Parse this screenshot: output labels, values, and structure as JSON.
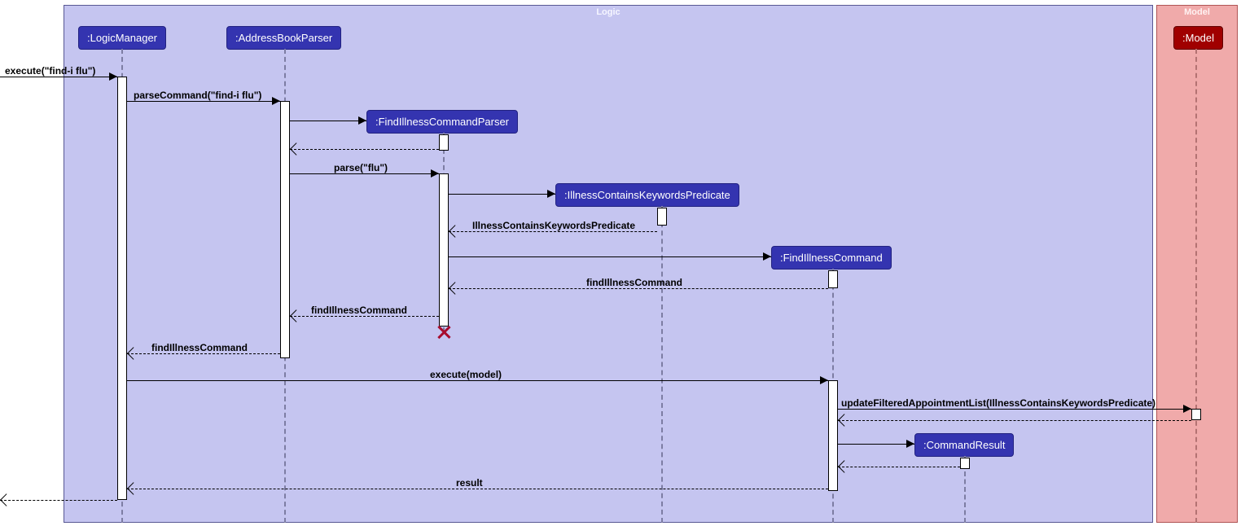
{
  "regions": {
    "logic": "Logic",
    "model": "Model"
  },
  "lifelines": {
    "logicManager": ":LogicManager",
    "addressBookParser": ":AddressBookParser",
    "findIllnessCommandParser": ":FindIllnessCommandParser",
    "illnessContainsKeywordsPredicate": ":IllnessContainsKeywordsPredicate",
    "findIllnessCommand": ":FindIllnessCommand",
    "commandResult": ":CommandResult",
    "model": ":Model"
  },
  "messages": {
    "m1": "execute(\"find-i flu\")",
    "m2": "parseCommand(\"find-i flu\")",
    "m3": "",
    "m4": "",
    "m5": "parse(\"flu\")",
    "m6": "",
    "m7": "IllnessContainsKeywordsPredicate",
    "m8": "",
    "m9": "findIllnessCommand",
    "m10": "findIllnessCommand",
    "m11": "findIllnessCommand",
    "m12": "execute(model)",
    "m13": "updateFilteredAppointmentList(IllnessContainsKeywordsPredicate)",
    "m14": "",
    "m15": "",
    "m16": "",
    "m17": "result",
    "m18": ""
  }
}
